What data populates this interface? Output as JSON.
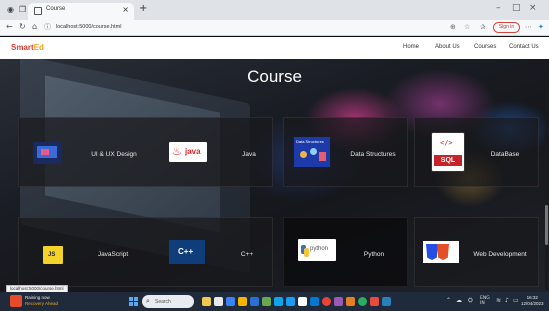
{
  "browser": {
    "tab_title": "Course",
    "url": "localhost:5000/course.html",
    "signin_label": "Sign in",
    "status_url": "localhost:5000/course.html"
  },
  "site": {
    "logo_main": "Smart",
    "logo_accent": "Ed",
    "nav": [
      "Home",
      "About Us",
      "Courses",
      "Contact Us"
    ]
  },
  "hero": {
    "title": "Course"
  },
  "courses": [
    {
      "label": "UI & UX Design",
      "icon": "ui-ux-design-icon"
    },
    {
      "label": "Java",
      "icon": "java-logo-icon",
      "icon_text": "java"
    },
    {
      "label": "Data Structures",
      "icon": "data-structures-icon",
      "icon_text": "Data Structures"
    },
    {
      "label": "DataBase",
      "icon": "sql-database-icon",
      "icon_text": "SQL"
    },
    {
      "label": "JavaScript",
      "icon": "javascript-logo-icon",
      "icon_text": "JS"
    },
    {
      "label": "C++",
      "icon": "cpp-logo-icon",
      "icon_text": "C++"
    },
    {
      "label": "Python",
      "icon": "python-logo-icon",
      "icon_text": "python"
    },
    {
      "label": "Web Development",
      "icon": "html5-css3-icon"
    }
  ],
  "taskbar": {
    "weather_temp": "Raining now",
    "weather_note": "Recovery Ahead",
    "search_placeholder": "Search",
    "time": "16:32",
    "date": "12/04/2023"
  },
  "colors": {
    "accent": "#e03b2e",
    "logo_accent": "#f0a21a",
    "signin": "#d4473f",
    "taskbar": "#1f2a3a"
  }
}
